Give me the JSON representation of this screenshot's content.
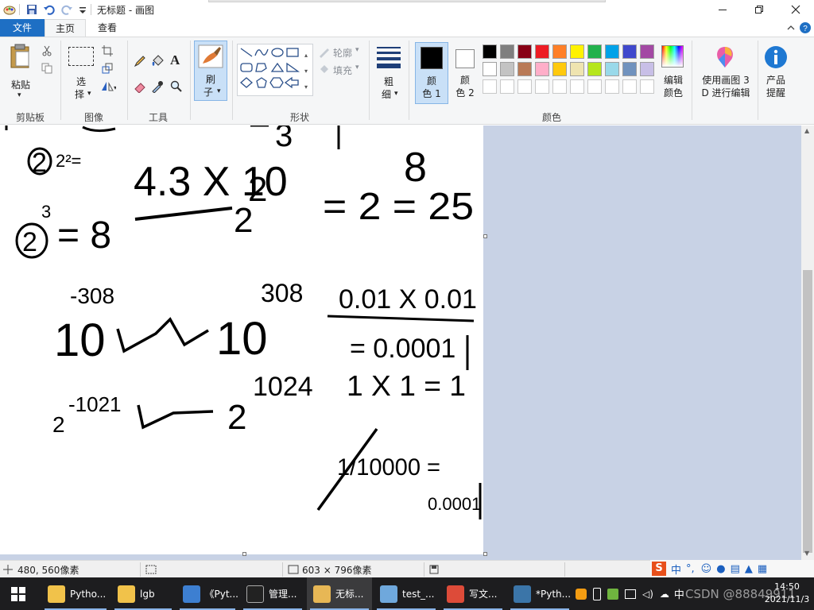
{
  "window": {
    "title": "无标题 - 画图",
    "minimize_icon": "minimize-icon",
    "maximize_icon": "restore-icon",
    "close_icon": "close-icon"
  },
  "tabs": {
    "file": "文件",
    "home": "主页",
    "view": "查看"
  },
  "ribbon": {
    "clipboard": {
      "paste": "粘贴",
      "group": "剪贴板"
    },
    "image": {
      "select_1": "选",
      "select_2": "择",
      "group": "图像"
    },
    "tools": {
      "group": "工具"
    },
    "brush": {
      "label_1": "刷",
      "label_2": "子"
    },
    "shapes": {
      "outline": "轮廓",
      "fill": "填充",
      "group": "形状"
    },
    "size": {
      "label_1": "粗",
      "label_2": "细"
    },
    "color1": {
      "label_1": "颜",
      "label_2": "色 1",
      "value": "#000000"
    },
    "color2": {
      "label_1": "颜",
      "label_2": "色 2",
      "value": "#ffffff"
    },
    "colors_group": "颜色",
    "edit_colors": {
      "label_1": "编辑",
      "label_2": "颜色"
    },
    "paint3d": {
      "label_1": "使用画图 3",
      "label_2": "D 进行编辑"
    },
    "product": {
      "label_1": "产品",
      "label_2": "提醒"
    },
    "palette_row1": [
      "#000000",
      "#7f7f7f",
      "#880015",
      "#ed1c24",
      "#ff7f27",
      "#fff200",
      "#22b14c",
      "#00a2e8",
      "#3f48cc",
      "#a349a4"
    ],
    "palette_row2": [
      "#ffffff",
      "#c3c3c3",
      "#b97a57",
      "#ffaec9",
      "#ffc90e",
      "#efe4b0",
      "#b5e61d",
      "#99d9ea",
      "#7092be",
      "#c8bfe7"
    ]
  },
  "canvas": {
    "handwriting": {
      "t1": "2",
      "t2": "2²=",
      "t3": "4.3 X 10",
      "t4": "2",
      "t5": "2",
      "t6": "= 2 = 25",
      "t7": "3",
      "t8": "8",
      "t9": "2",
      "t10": "3",
      "t11": "= 8",
      "t12": "-308",
      "t13": "10",
      "t14": "10",
      "t15": "308",
      "t16": "0.01 X 0.01",
      "t17": "= 0.0001",
      "t18": "-1021",
      "t19": "2",
      "t20": "2",
      "t21": "1024",
      "t22": "1 X 1 = 1",
      "t23": "1/10000 =",
      "t24": "0.0001"
    }
  },
  "status": {
    "position": "480, 560像素",
    "size": "603 × 796像素"
  },
  "taskbar": {
    "items": [
      {
        "label": "Pytho...",
        "icon": "folder-icon"
      },
      {
        "label": "lgb",
        "icon": "folder-icon"
      },
      {
        "label": "《Pyt...",
        "icon": "notepad-icon"
      },
      {
        "label": "管理...",
        "icon": "terminal-icon"
      },
      {
        "label": "无标...",
        "icon": "paint-icon"
      },
      {
        "label": "test_...",
        "icon": "notebook-icon"
      },
      {
        "label": "写文...",
        "icon": "chrome-icon"
      },
      {
        "label": "*Pyth...",
        "icon": "python-icon"
      }
    ],
    "ime": "中",
    "ime2": "中",
    "time": "14:50",
    "date": "2021/11/3",
    "watermark": "CSDN @88849911"
  }
}
